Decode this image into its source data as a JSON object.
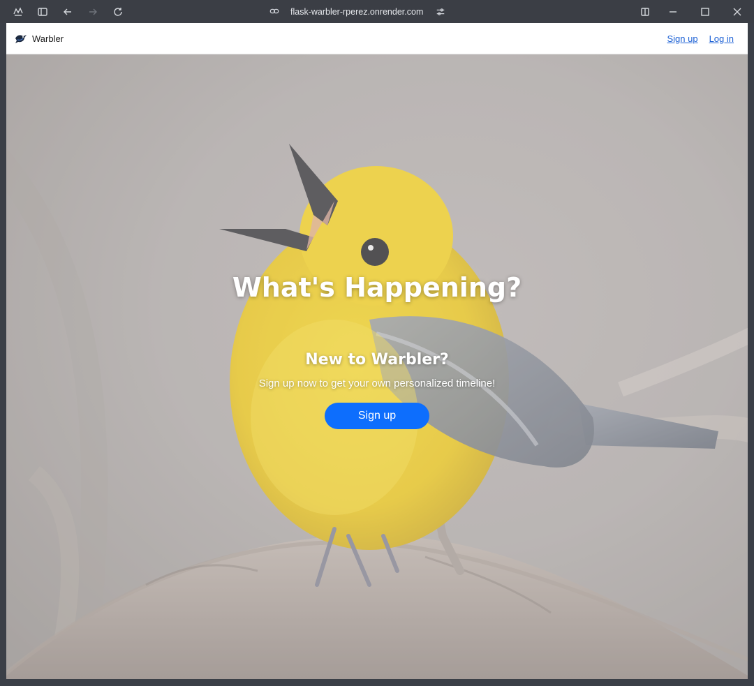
{
  "browser": {
    "url": "flask-warbler-rperez.onrender.com",
    "icons": [
      "copilot-icon",
      "sidebar-icon",
      "back-icon",
      "forward-icon",
      "refresh-icon",
      "link-icon",
      "site-settings-icon",
      "split-view-icon",
      "minimize-icon",
      "maximize-icon",
      "close-icon"
    ]
  },
  "navbar": {
    "brand": "Warbler",
    "links": {
      "signup": "Sign up",
      "login": "Log in"
    },
    "link_color": "#1a5fd4"
  },
  "hero": {
    "headline": "What's Happening?",
    "subheading": "New to Warbler?",
    "text": "Sign up now to get your own personalized timeline!",
    "button": "Sign up",
    "button_color": "#0d6efd",
    "image": "yellow-warbler-bird-photo"
  }
}
